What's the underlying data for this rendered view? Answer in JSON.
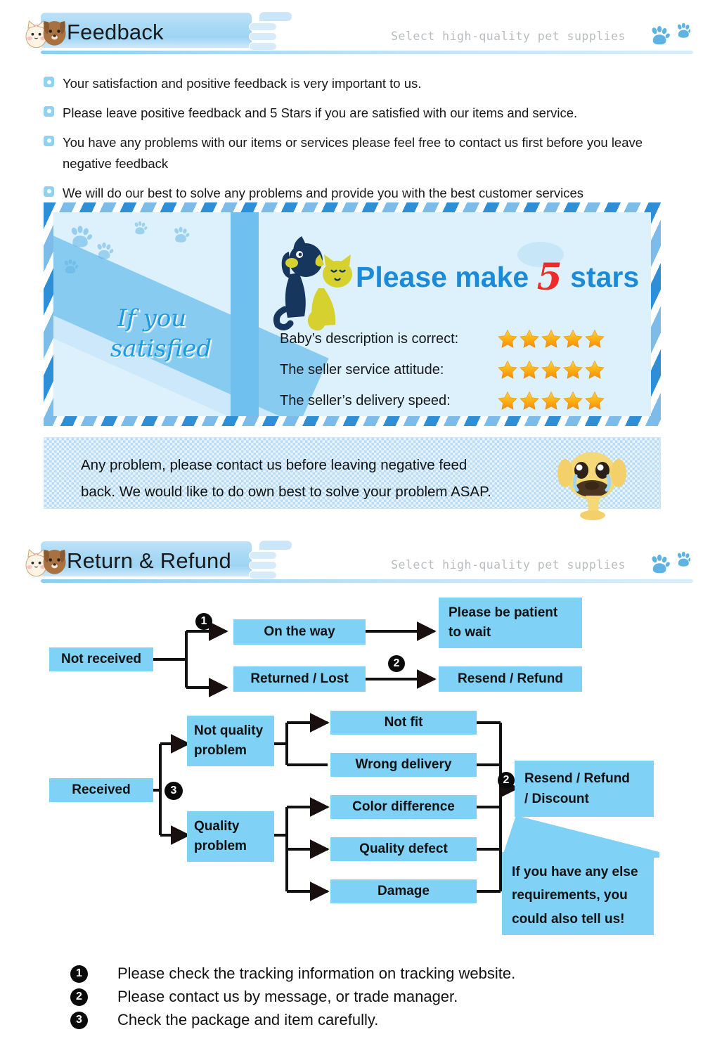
{
  "colors": {
    "accent_blue": "#7fd1f5",
    "header_badge": "#a8d9f5",
    "headline_blue": "#1a8ad9",
    "five_red": "#ee2b2b",
    "star_orange": "#f9a01b",
    "tagline_grey": "#b9bcc0"
  },
  "feedback_section": {
    "header": {
      "title": "Feedback",
      "tagline": "Select high-quality pet supplies",
      "pets_icon": "dog-and-cat-icon",
      "paws_icon": "paw-prints-icon",
      "hand_icon": "pointing-hand-icon"
    },
    "bullets": [
      "Your satisfaction and positive feedback is very important to us.",
      "Please leave positive feedback and 5 Stars if you are satisfied with our items and service.",
      "You have any problems with our items or services please feel free to contact us first before you  leave negative feedback",
      "We will do our best to solve any problems and provide you with the best customer services"
    ]
  },
  "star_banner": {
    "script_line1": "If you",
    "script_line2": "satisfied",
    "headline_before": "Please make ",
    "headline_five": "5",
    "headline_after": " stars",
    "pets_icon": "dog-and-cat-illustration",
    "ratings": [
      {
        "label": "Baby’s description is correct:",
        "stars": 5
      },
      {
        "label": "The  seller  service  attitude:",
        "stars": 5
      },
      {
        "label": "The seller’s delivery speed:",
        "stars": 5
      }
    ]
  },
  "asap_box": {
    "line1": "Any problem,  please contact us before leaving negative feed",
    "line2": "back. We would like to do own best to solve your problem ASAP.",
    "dog_icon": "crying-dog-emoji"
  },
  "return_section": {
    "header": {
      "title": "Return & Refund",
      "tagline": "Select high-quality pet supplies",
      "pets_icon": "dog-and-cat-icon",
      "paws_icon": "paw-prints-icon",
      "hand_icon": "pointing-hand-icon"
    },
    "flow_boxes": {
      "not_received": "Not received",
      "on_the_way": "On the way",
      "returned_lost": "Returned / Lost",
      "please_be_patient": "Please be patient\nto wait",
      "resend_refund": "Resend / Refund",
      "received": "Received",
      "not_quality_problem": "Not quality\nproblem",
      "quality_problem": "Quality\nproblem",
      "not_fit": "Not fit",
      "wrong_delivery": "Wrong delivery",
      "color_difference": "Color difference",
      "quality_defect": "Quality defect",
      "damage": "Damage",
      "resend_refund_discount": "Resend / Refund\n/ Discount",
      "bubble": "If you have any else\nrequirements, you\ncould also tell us!"
    },
    "markers": {
      "one": "1",
      "two": "2",
      "three": "3",
      "two_b": "2"
    }
  },
  "footer_notes": [
    {
      "num": "1",
      "text": "Please check the tracking information on tracking website."
    },
    {
      "num": "2",
      "text": "Please contact us by message, or trade manager."
    },
    {
      "num": "3",
      "text": "Check the package and item carefully."
    }
  ]
}
